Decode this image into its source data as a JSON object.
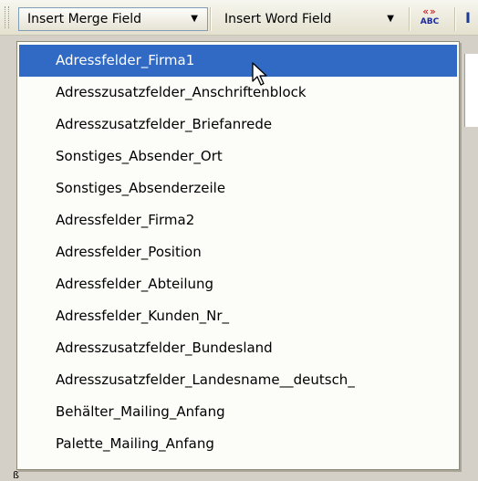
{
  "toolbar": {
    "insert_merge_field_label": "Insert Merge Field",
    "insert_word_field_label": "Insert Word Field",
    "dropdown_arrow": "▼",
    "merge_icon_quotes": "«»",
    "merge_icon_text": "ABC",
    "edge_glyph": "I"
  },
  "dropdown": {
    "selected_index": 0,
    "items": [
      {
        "label": "Adressfelder_Firma1"
      },
      {
        "label": "Adresszusatzfelder_Anschriftenblock"
      },
      {
        "label": "Adresszusatzfelder_Briefanrede"
      },
      {
        "label": "Sonstiges_Absender_Ort"
      },
      {
        "label": "Sonstiges_Absenderzeile"
      },
      {
        "label": "Adressfelder_Firma2"
      },
      {
        "label": "Adressfelder_Position"
      },
      {
        "label": "Adressfelder_Abteilung"
      },
      {
        "label": "Adressfelder_Kunden_Nr_"
      },
      {
        "label": "Adresszusatzfelder_Bundesland"
      },
      {
        "label": "Adresszusatzfelder_Landesname__deutsch_"
      },
      {
        "label": "Behälter_Mailing_Anfang"
      },
      {
        "label": "Palette_Mailing_Anfang"
      }
    ]
  },
  "document": {
    "corner_glyph": "ß"
  },
  "colors": {
    "selection": "#316ac5",
    "menu_background": "#fcfcf9",
    "toolbar_background": "#ece9d8"
  }
}
